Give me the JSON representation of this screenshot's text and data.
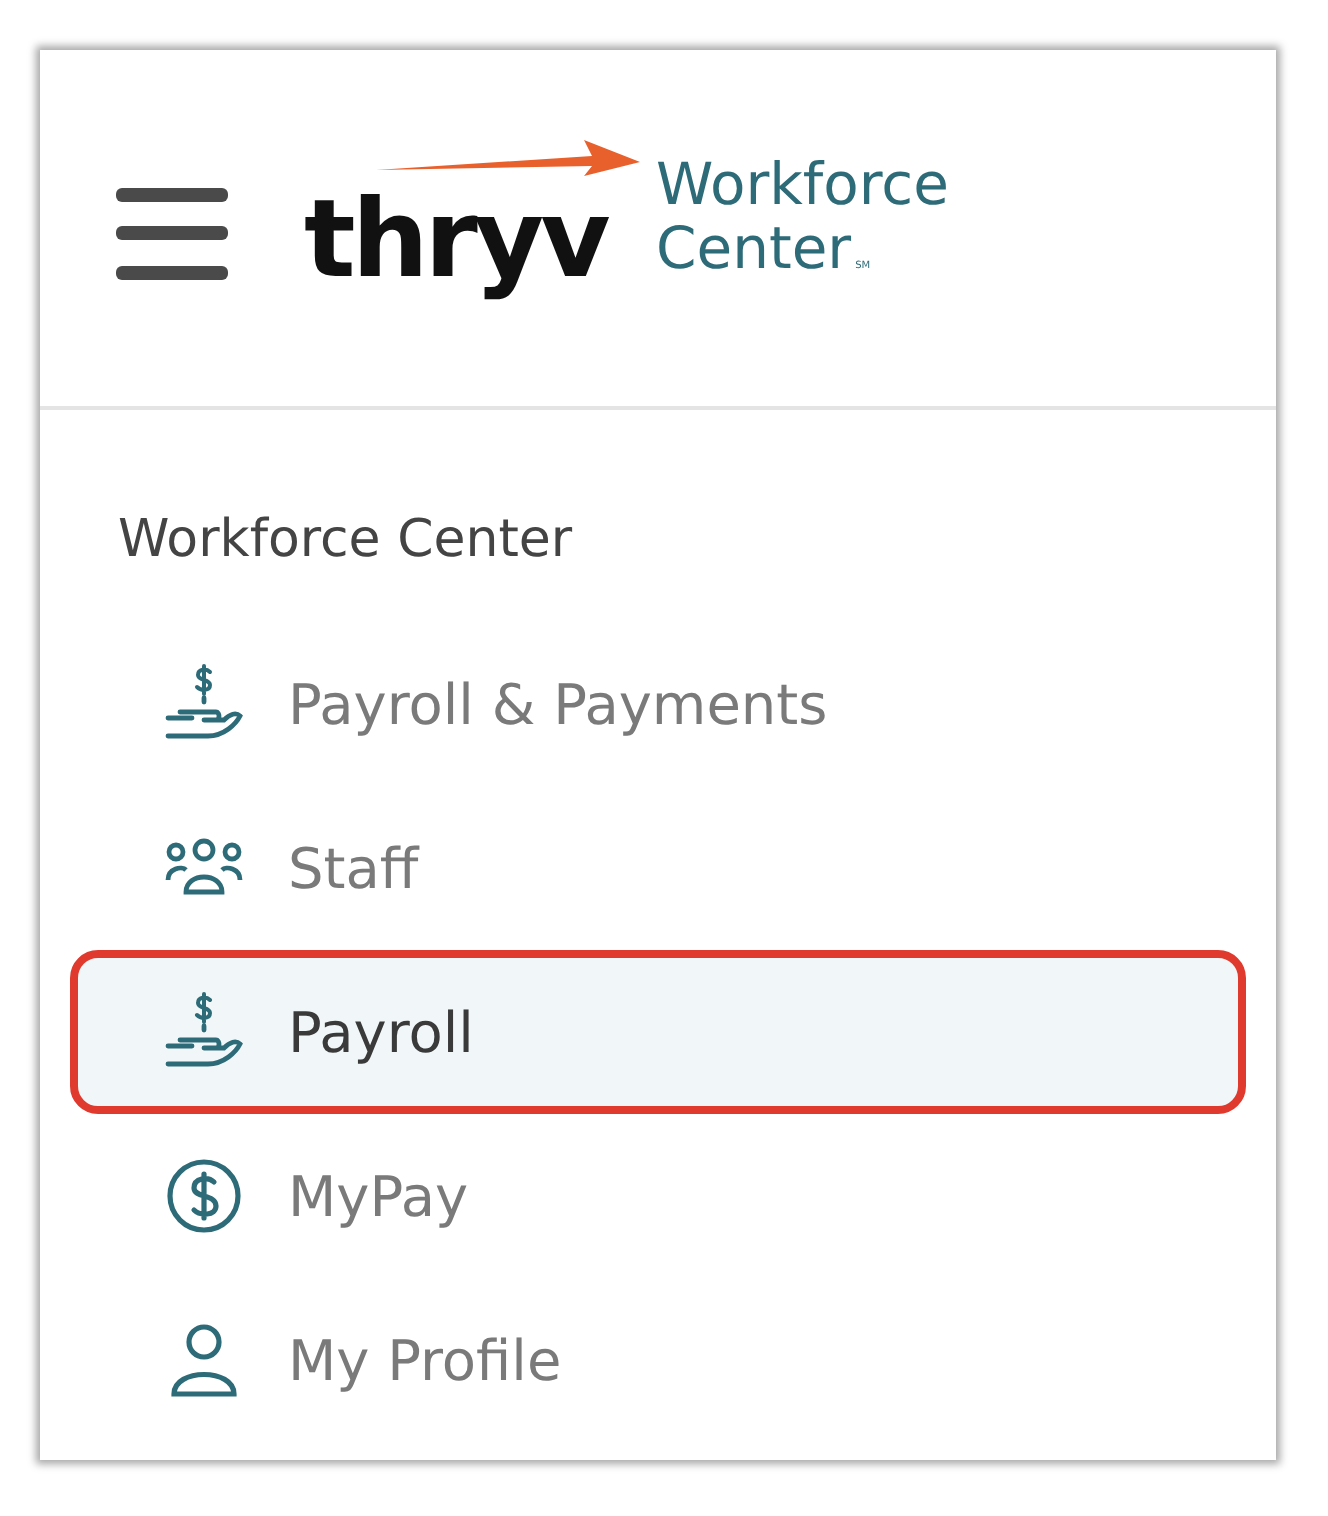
{
  "header": {
    "logo": {
      "brand": "thryv",
      "product_line_1": "Workforce",
      "product_line_2": "Center",
      "mark": "SM"
    }
  },
  "nav": {
    "heading": "Workforce Center",
    "items": [
      {
        "label": "Payroll & Payments",
        "kind": "hand-dollar",
        "selected": false
      },
      {
        "label": "Staff",
        "kind": "people",
        "selected": false
      },
      {
        "label": "Payroll",
        "kind": "hand-dollar",
        "selected": true
      },
      {
        "label": "MyPay",
        "kind": "coin",
        "selected": false
      },
      {
        "label": "My Profile",
        "kind": "person",
        "selected": false
      }
    ]
  }
}
